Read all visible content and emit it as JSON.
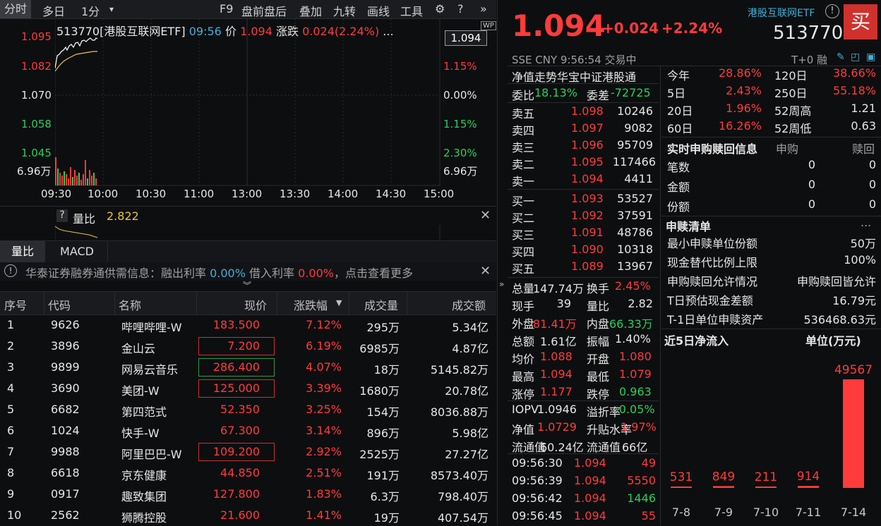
{
  "toolbar": {
    "items": [
      "分时",
      "多日",
      "1分",
      "F9",
      "盘前盘后",
      "叠加",
      "九转",
      "画线",
      "工具"
    ]
  },
  "chart": {
    "header": {
      "code_name": "513770[港股互联网ETF]",
      "time": "09:56",
      "price_label": "价",
      "price": "1.094",
      "change_label": "涨跌",
      "change": "0.024(2.24%)",
      "more": "..."
    },
    "price_tag": "1.094",
    "wp_badge": "WP",
    "left_axis": [
      "1.095",
      "1.082",
      "1.070",
      "1.058",
      "1.045",
      "6.96万"
    ],
    "right_axis": [
      "1.15%",
      "0.00%",
      "1.15%",
      "2.30%",
      "6.96万"
    ],
    "x_axis": [
      "09:30",
      "10:00",
      "10:30",
      "11:00",
      "13:00",
      "13:30",
      "14:00",
      "14:30",
      "15:00"
    ]
  },
  "lower": {
    "help": "?",
    "label": "量比",
    "value": "2.822"
  },
  "tabs2": [
    "量比",
    "MACD"
  ],
  "notice": {
    "text_a": "华泰证券融券通供需信息：融出利率",
    "rate1": "0.00%",
    "text_b": "借入利率",
    "rate2": "0.00%",
    "text_c": "，点击查看更多"
  },
  "table": {
    "headers": [
      "序号",
      "代码",
      "名称",
      "现价",
      "涨跌幅",
      "成交量",
      "成交额"
    ],
    "rows": [
      [
        "1",
        "9626",
        "哔哩哔哩-W",
        "183.500",
        "7.12%",
        "295万",
        "5.34亿"
      ],
      [
        "2",
        "3896",
        "金山云",
        "7.200",
        "6.19%",
        "6985万",
        "4.87亿"
      ],
      [
        "3",
        "9899",
        "网易云音乐",
        "286.400",
        "4.07%",
        "18万",
        "5145.82万"
      ],
      [
        "4",
        "3690",
        "美团-W",
        "125.000",
        "3.39%",
        "1680万",
        "20.78亿"
      ],
      [
        "5",
        "6682",
        "第四范式",
        "52.350",
        "3.25%",
        "154万",
        "8036.88万"
      ],
      [
        "6",
        "1024",
        "快手-W",
        "67.300",
        "3.14%",
        "896万",
        "5.98亿"
      ],
      [
        "7",
        "9988",
        "阿里巴巴-W",
        "109.200",
        "2.92%",
        "2525万",
        "27.27亿"
      ],
      [
        "8",
        "6618",
        "京东健康",
        "44.850",
        "2.51%",
        "191万",
        "8573.40万"
      ],
      [
        "9",
        "0917",
        "趣致集团",
        "127.800",
        "1.83%",
        "6.3万",
        "798.40万"
      ],
      [
        "10",
        "2562",
        "狮腾控股",
        "21.600",
        "1.41%",
        "19万",
        "407.54万"
      ]
    ]
  },
  "quote": {
    "price": "1.094",
    "change": "+0.024",
    "pct": "+2.24%",
    "name": "港股互联网ETF",
    "code": "513770",
    "buy_label": "买",
    "sub": "SSE  CNY  9:56:54  交易中",
    "tplus": "T+0  融",
    "desc": "净值走势华宝中证港股通",
    "weibi_label": "委比",
    "weibi": "18.13%",
    "weicha_label": "委差",
    "weicha": "-72725",
    "sells": [
      [
        "卖五",
        "1.098",
        "10246"
      ],
      [
        "卖四",
        "1.097",
        "9082"
      ],
      [
        "卖三",
        "1.096",
        "95709"
      ],
      [
        "卖二",
        "1.095",
        "117466"
      ],
      [
        "卖一",
        "1.094",
        "4411"
      ]
    ],
    "buys": [
      [
        "买一",
        "1.093",
        "53527"
      ],
      [
        "买二",
        "1.092",
        "37591"
      ],
      [
        "买三",
        "1.091",
        "48786"
      ],
      [
        "买四",
        "1.090",
        "10318"
      ],
      [
        "买五",
        "1.089",
        "13967"
      ]
    ],
    "stats": [
      [
        "总量",
        "147.74万",
        "换手",
        "2.45%"
      ],
      [
        "现手",
        "39",
        "量比",
        "2.82"
      ],
      [
        "外盘",
        "81.41万",
        "内盘",
        "66.33万"
      ],
      [
        "总额",
        "1.61亿",
        "振幅",
        "1.40%"
      ],
      [
        "均价",
        "1.088",
        "开盘",
        "1.080"
      ],
      [
        "最高",
        "1.094",
        "最低",
        "1.079"
      ],
      [
        "涨停",
        "1.177",
        "跌停",
        "0.963"
      ]
    ],
    "iopv": [
      [
        "IOPV",
        "1.0946",
        "溢折率",
        "-0.05%"
      ],
      [
        "净值",
        "1.0729",
        "升贴水率",
        "1.97%"
      ],
      [
        "流通值",
        "60.24亿",
        "流通值",
        "66亿"
      ]
    ],
    "ticks": [
      [
        "09:56:30",
        "1.094",
        "49"
      ],
      [
        "09:56:39",
        "1.094",
        "5550"
      ],
      [
        "09:56:42",
        "1.094",
        "1446"
      ],
      [
        "09:56:45",
        "1.094",
        "55"
      ]
    ]
  },
  "perf": [
    [
      "今年",
      "28.86%",
      "120日",
      "38.66%"
    ],
    [
      "5日",
      "2.43%",
      "250日",
      "55.18%"
    ],
    [
      "20日",
      "1.96%",
      "52周高",
      "1.21"
    ],
    [
      "60日",
      "16.26%",
      "52周低",
      "0.63"
    ]
  ],
  "subscribe": {
    "title": "实时申购赎回信息",
    "col1": "申购",
    "col2": "赎回",
    "rows": [
      [
        "笔数",
        "0",
        "0"
      ],
      [
        "金额",
        "0",
        "0"
      ],
      [
        "份额",
        "0",
        "0"
      ]
    ]
  },
  "list": {
    "title": "申赎清单",
    "more": "...",
    "rows": [
      [
        "最小申赎单位份额",
        "50万"
      ],
      [
        "现金替代比例上限",
        "100%"
      ],
      [
        "申购赎回允许情况",
        "申购赎回皆允许"
      ],
      [
        "T日预估现金差额",
        "16.79元"
      ],
      [
        "T-1日单位申赎资产",
        "536468.63元"
      ]
    ]
  },
  "flow": {
    "title": "近5日净流入",
    "unit": "单位(万元)"
  },
  "chart_data": {
    "type": "bar",
    "categories": [
      "7-8",
      "7-9",
      "7-10",
      "7-11",
      "7-14"
    ],
    "values": [
      531,
      849,
      211,
      914,
      49567
    ],
    "title": "近5日净流入",
    "ylabel": "单位(万元)"
  }
}
